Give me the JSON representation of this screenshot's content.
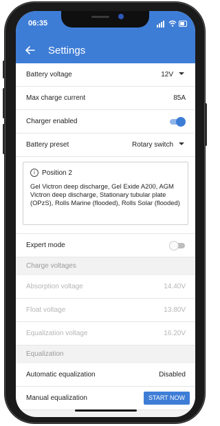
{
  "status_bar": {
    "time": "06:35"
  },
  "app_bar": {
    "title": "Settings"
  },
  "rows": {
    "battery_voltage": {
      "label": "Battery voltage",
      "value": "12V"
    },
    "max_charge_current": {
      "label": "Max charge current",
      "value": "85A"
    },
    "charger_enabled": {
      "label": "Charger enabled",
      "on": true
    },
    "battery_preset": {
      "label": "Battery preset",
      "value": "Rotary switch"
    },
    "expert_mode": {
      "label": "Expert mode",
      "on": false
    }
  },
  "info_box": {
    "title": "Position 2",
    "body": "Gel Victron deep discharge, Gel Exide A200, AGM Victron deep discharge, Stationary tubular plate (OPzS), Rolls Marine (flooded), Rolls Solar (flooded)"
  },
  "charge_voltages": {
    "header": "Charge voltages",
    "absorption": {
      "label": "Absorption voltage",
      "value": "14.40V"
    },
    "float": {
      "label": "Float voltage",
      "value": "13.80V"
    },
    "equalization": {
      "label": "Equalization voltage",
      "value": "16.20V"
    }
  },
  "equalization": {
    "header": "Equalization",
    "automatic": {
      "label": "Automatic equalization",
      "value": "Disabled"
    },
    "manual": {
      "label": "Manual equalization",
      "button": "START NOW"
    }
  },
  "colors": {
    "accent": "#3e7dd6",
    "background": "#f2f2f2",
    "disabled_text": "#b5b5b5"
  },
  "icons": {
    "back": "arrow-left-icon",
    "info": "info-circle-icon",
    "dropdown": "caret-down-icon"
  }
}
